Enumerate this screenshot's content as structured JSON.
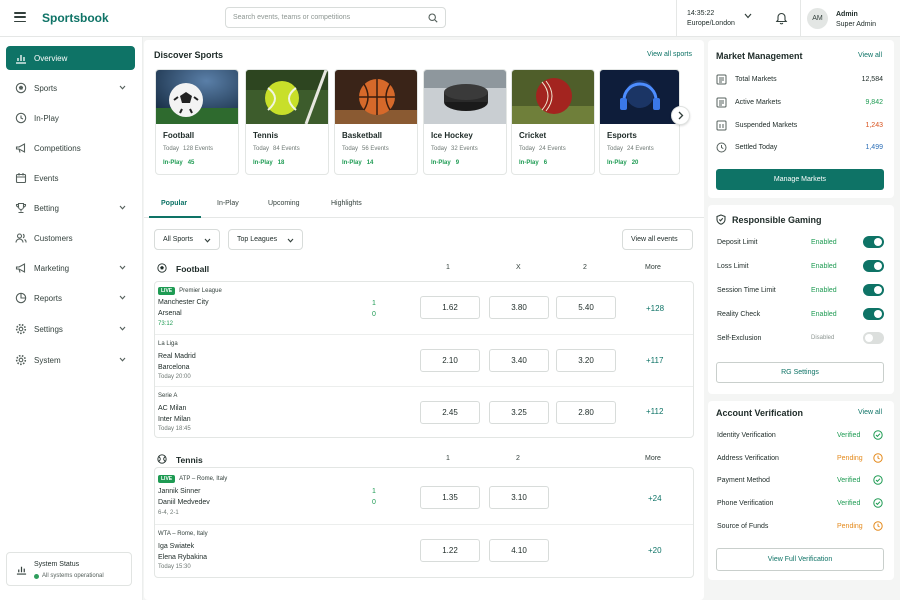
{
  "header": {
    "brand": "Sportsbook",
    "search_placeholder": "Search events, teams or competitions",
    "time": "14:35:22",
    "timezone": "Europe/London",
    "avatar_initials": "AM",
    "user_name": "Admin",
    "user_role": "Super Admin"
  },
  "sidebar": {
    "items": [
      {
        "label": "Overview",
        "icon": "chart-icon"
      },
      {
        "label": "Sports",
        "icon": "ball-icon"
      },
      {
        "label": "In-Play",
        "icon": "clock-icon"
      },
      {
        "label": "Competitions",
        "icon": "megaphone-icon"
      },
      {
        "label": "Events",
        "icon": "calendar-icon"
      },
      {
        "label": "Betting",
        "icon": "trophy-icon"
      },
      {
        "label": "Customers",
        "icon": "users-icon"
      },
      {
        "label": "Marketing",
        "icon": "megaphone-icon"
      },
      {
        "label": "Reports",
        "icon": "report-icon"
      },
      {
        "label": "Settings",
        "icon": "gear-icon"
      },
      {
        "label": "System",
        "icon": "gear-icon"
      }
    ],
    "status_title": "System Status",
    "status_text": "All systems operational"
  },
  "discover": {
    "title": "Discover Sports",
    "view_all": "View all sports",
    "sports": [
      {
        "name": "Football",
        "today_label": "Today",
        "events": "128 Events",
        "inplay_label": "In-Play",
        "inplay": "45"
      },
      {
        "name": "Tennis",
        "today_label": "Today",
        "events": "84 Events",
        "inplay_label": "In-Play",
        "inplay": "18"
      },
      {
        "name": "Basketball",
        "today_label": "Today",
        "events": "56 Events",
        "inplay_label": "In-Play",
        "inplay": "14"
      },
      {
        "name": "Ice Hockey",
        "today_label": "Today",
        "events": "32 Events",
        "inplay_label": "In-Play",
        "inplay": "9"
      },
      {
        "name": "Cricket",
        "today_label": "Today",
        "events": "24 Events",
        "inplay_label": "In-Play",
        "inplay": "6"
      },
      {
        "name": "Esports",
        "today_label": "Today",
        "events": "24 Events",
        "inplay_label": "In-Play",
        "inplay": "20"
      }
    ]
  },
  "tabs": [
    "Popular",
    "In-Play",
    "Upcoming",
    "Highlights"
  ],
  "filters": {
    "sports": "All Sports",
    "leagues": "Top Leagues",
    "view_all_events": "View all events"
  },
  "football": {
    "title": "Football",
    "cols": [
      "1",
      "X",
      "2",
      "More"
    ],
    "events": [
      {
        "live": "LIVE",
        "league": "Premier League",
        "home": "Manchester City",
        "away": "Arsenal",
        "time": "73:12",
        "score_home": "1",
        "score_away": "0",
        "odds": [
          "1.62",
          "3.80",
          "5.40"
        ],
        "more": "+128"
      },
      {
        "live": "",
        "league": "La Liga",
        "home": "Real Madrid",
        "away": "Barcelona",
        "time": "Today 20:00",
        "score_home": "",
        "score_away": "",
        "odds": [
          "2.10",
          "3.40",
          "3.20"
        ],
        "more": "+117"
      },
      {
        "live": "",
        "league": "Serie A",
        "home": "AC Milan",
        "away": "Inter Milan",
        "time": "Today 18:45",
        "score_home": "",
        "score_away": "",
        "odds": [
          "2.45",
          "3.25",
          "2.80"
        ],
        "more": "+112"
      }
    ]
  },
  "tennis": {
    "title": "Tennis",
    "cols": [
      "1",
      "2",
      "More"
    ],
    "events": [
      {
        "live": "LIVE",
        "league": "ATP – Rome, Italy",
        "home": "Jannik Sinner",
        "away": "Daniil Medvedev",
        "time": "6-4, 2-1",
        "score_home": "1",
        "score_away": "0",
        "odds": [
          "1.35",
          "3.10"
        ],
        "more": "+24"
      },
      {
        "live": "",
        "league": "WTA – Rome, Italy",
        "home": "Iga Swiatek",
        "away": "Elena Rybakina",
        "time": "Today 15:30",
        "score_home": "",
        "score_away": "",
        "odds": [
          "1.22",
          "4.10"
        ],
        "more": "+20"
      }
    ]
  },
  "market": {
    "title": "Market Management",
    "view_all": "View all",
    "rows": [
      {
        "label": "Total Markets",
        "value": "12,584",
        "color": "#1d2a27"
      },
      {
        "label": "Active Markets",
        "value": "9,842",
        "color": "#1e9b53"
      },
      {
        "label": "Suspended Markets",
        "value": "1,243",
        "color": "#d9531e"
      },
      {
        "label": "Settled Today",
        "value": "1,499",
        "color": "#2c6fb7"
      }
    ],
    "button": "Manage Markets"
  },
  "rg": {
    "title": "Responsible Gaming",
    "rows": [
      {
        "label": "Deposit Limit",
        "status": "Enabled",
        "on": true
      },
      {
        "label": "Loss Limit",
        "status": "Enabled",
        "on": true
      },
      {
        "label": "Session Time Limit",
        "status": "Enabled",
        "on": true
      },
      {
        "label": "Reality Check",
        "status": "Enabled",
        "on": true
      },
      {
        "label": "Self-Exclusion",
        "status": "Disabled",
        "on": false
      }
    ],
    "button": "RG Settings"
  },
  "verification": {
    "title": "Account Verification",
    "view_all": "View all",
    "rows": [
      {
        "label": "Identity Verification",
        "status": "Verified"
      },
      {
        "label": "Address Verification",
        "status": "Pending"
      },
      {
        "label": "Payment Method",
        "status": "Verified"
      },
      {
        "label": "Phone Verification",
        "status": "Verified"
      },
      {
        "label": "Source of Funds",
        "status": "Pending"
      }
    ],
    "button": "View Full Verification"
  },
  "colors": {
    "accent": "#0e7366",
    "live": "#1e9b53",
    "pending": "#e48a1c",
    "verified": "#1e9b53"
  }
}
